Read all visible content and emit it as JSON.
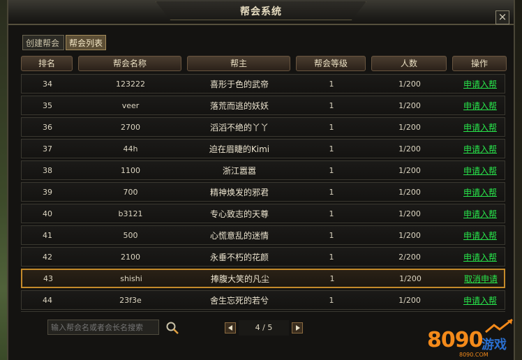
{
  "window": {
    "title": "帮会系统",
    "close_label": "×"
  },
  "tabs": [
    {
      "label": "创建帮会"
    },
    {
      "label": "帮会列表",
      "active": true
    }
  ],
  "table": {
    "headers": [
      "排名",
      "帮会名称",
      "帮主",
      "帮会等级",
      "人数",
      "操作"
    ],
    "rows": [
      {
        "rank": "34",
        "guild": "123222",
        "leader": "喜形于色的武帝",
        "level": "1",
        "members": "1/200",
        "action": "申请入帮"
      },
      {
        "rank": "35",
        "guild": "veer",
        "leader": "落荒而逃的妖妖",
        "level": "1",
        "members": "1/200",
        "action": "申请入帮"
      },
      {
        "rank": "36",
        "guild": "2700",
        "leader": "滔滔不绝的丫丫",
        "level": "1",
        "members": "1/200",
        "action": "申请入帮"
      },
      {
        "rank": "37",
        "guild": "44h",
        "leader": "迫在眉睫的Kimi",
        "level": "1",
        "members": "1/200",
        "action": "申请入帮"
      },
      {
        "rank": "38",
        "guild": "1100",
        "leader": "浙江嚣嚣",
        "level": "1",
        "members": "1/200",
        "action": "申请入帮"
      },
      {
        "rank": "39",
        "guild": "700",
        "leader": "精神焕发的邪君",
        "level": "1",
        "members": "1/200",
        "action": "申请入帮"
      },
      {
        "rank": "40",
        "guild": "b3121",
        "leader": "专心致志的天尊",
        "level": "1",
        "members": "1/200",
        "action": "申请入帮"
      },
      {
        "rank": "41",
        "guild": "500",
        "leader": "心慌意乱的迷情",
        "level": "1",
        "members": "1/200",
        "action": "申请入帮"
      },
      {
        "rank": "42",
        "guild": "2100",
        "leader": "永垂不朽的花颜",
        "level": "1",
        "members": "2/200",
        "action": "申请入帮"
      },
      {
        "rank": "43",
        "guild": "shishi",
        "leader": "捧腹大笑的凡尘",
        "level": "1",
        "members": "1/200",
        "action": "取消申请",
        "selected": true
      },
      {
        "rank": "44",
        "guild": "23f3e",
        "leader": "舍生忘死的若兮",
        "level": "1",
        "members": "1/200",
        "action": "申请入帮"
      }
    ]
  },
  "search": {
    "placeholder": "输入帮会名或者会长名搜索"
  },
  "pagination": {
    "text": "4 / 5",
    "current": 4,
    "total": 5
  },
  "watermark": {
    "numbers": "8090",
    "name": "游戏",
    "url": "8090.COM"
  },
  "colors": {
    "action_link": "#28e64b",
    "selected_border": "#c48a2a",
    "logo_orange": "#f48a1a",
    "logo_blue": "#2a6fd0"
  }
}
